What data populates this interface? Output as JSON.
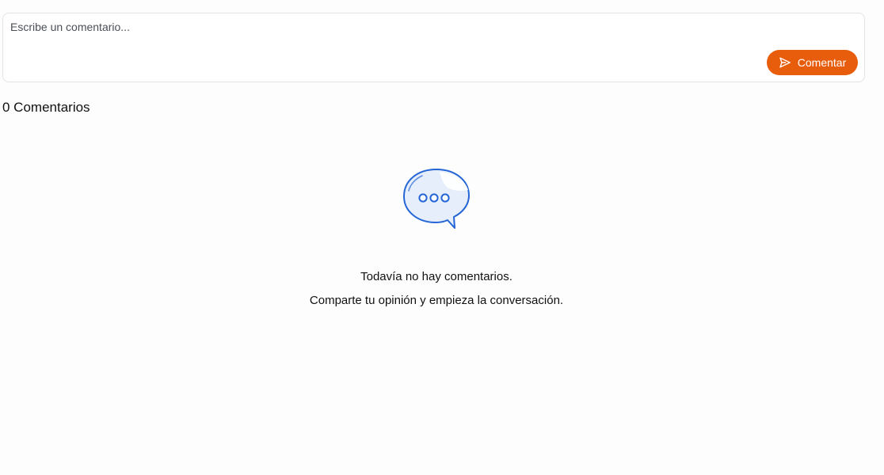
{
  "composer": {
    "placeholder": "Escribe un comentario...",
    "value": "",
    "submit_label": "Comentar",
    "submit_icon": "send-icon",
    "accent_color": "#e85d0c"
  },
  "comments": {
    "count_label": "0 Comentarios"
  },
  "empty_state": {
    "icon": "chat-bubble-icon",
    "title": "Todavía no hay comentarios.",
    "subtitle": "Comparte tu opinión y empieza la conversación.",
    "icon_color": "#2566d6"
  }
}
